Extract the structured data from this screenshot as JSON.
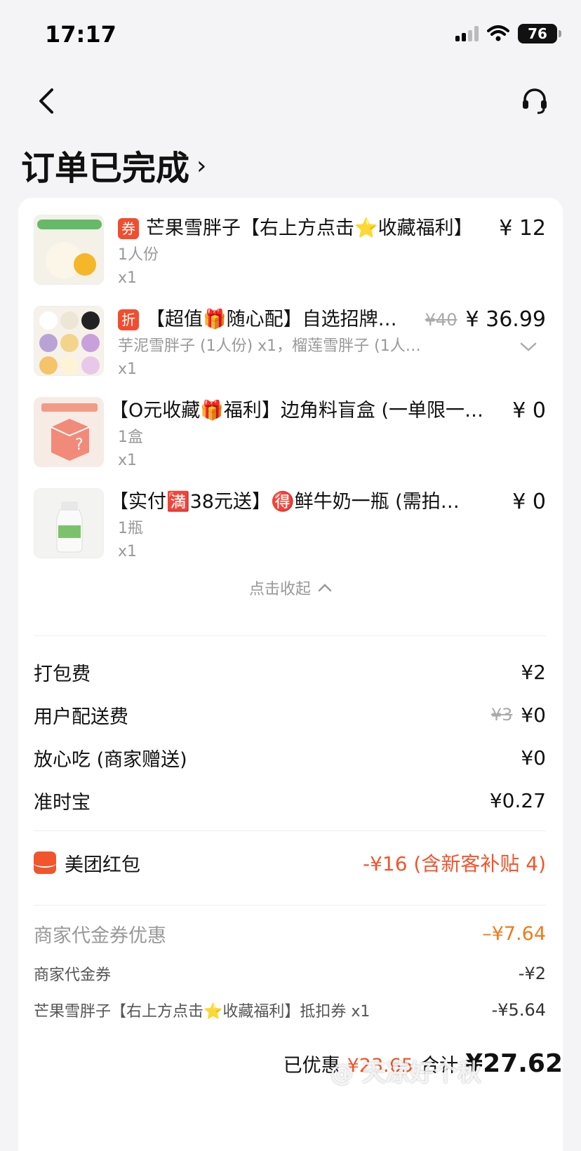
{
  "status_bar": {
    "time": "17:17",
    "battery": "76"
  },
  "header": {
    "title": "订单已完成"
  },
  "items": [
    {
      "tag": "券",
      "name": "芒果雪胖子【右上方点击⭐收藏福利】",
      "price": "¥ 12",
      "orig_price": "",
      "sub": "1人份",
      "qty": "x1"
    },
    {
      "tag": "折",
      "name": "【超值🎁随心配】自选招牌雪…",
      "price": "¥ 36.99",
      "orig_price": "¥40",
      "sub": "芋泥雪胖子 (1人份) x1，榴莲雪胖子 (1人…",
      "qty": "x1"
    },
    {
      "tag": "",
      "name": "【O元收藏🎁福利】边角料盲盒 (一单限一…",
      "price": "¥ 0",
      "orig_price": "",
      "sub": "1盒",
      "qty": "x1"
    },
    {
      "tag": "",
      "name": "【实付🈵38元送】🉐鲜牛奶一瓶 (需拍…",
      "price": "¥ 0",
      "orig_price": "",
      "sub": "1瓶",
      "qty": "x1"
    }
  ],
  "collapse_label": "点击收起",
  "fees": [
    {
      "label": "打包费",
      "value": "¥2",
      "orig": ""
    },
    {
      "label": "用户配送费",
      "value": "¥0",
      "orig": "¥3"
    },
    {
      "label": "放心吃 (商家赠送)",
      "value": "¥0",
      "orig": ""
    },
    {
      "label": "准时宝",
      "value": "¥0.27",
      "orig": ""
    }
  ],
  "redpack": {
    "label": "美团红包",
    "value": "-¥16 (含新客补贴 4)"
  },
  "coupons": {
    "head_label": "商家代金券优惠",
    "head_value": "–¥7.64",
    "rows": [
      {
        "label": "商家代金券",
        "value": "-¥2"
      },
      {
        "label": "芒果雪胖子【右上方点击⭐收藏福利】抵扣券 x1",
        "value": "-¥5.64"
      }
    ]
  },
  "summary": {
    "saved_label": "已优惠",
    "saved_value": "¥23.65",
    "total_label": "合计",
    "total_value": "¥27.62"
  },
  "watermark": "@ 天凉好个秋",
  "colors": {
    "accent": "#f2552c",
    "coupon": "#f27a1a"
  }
}
